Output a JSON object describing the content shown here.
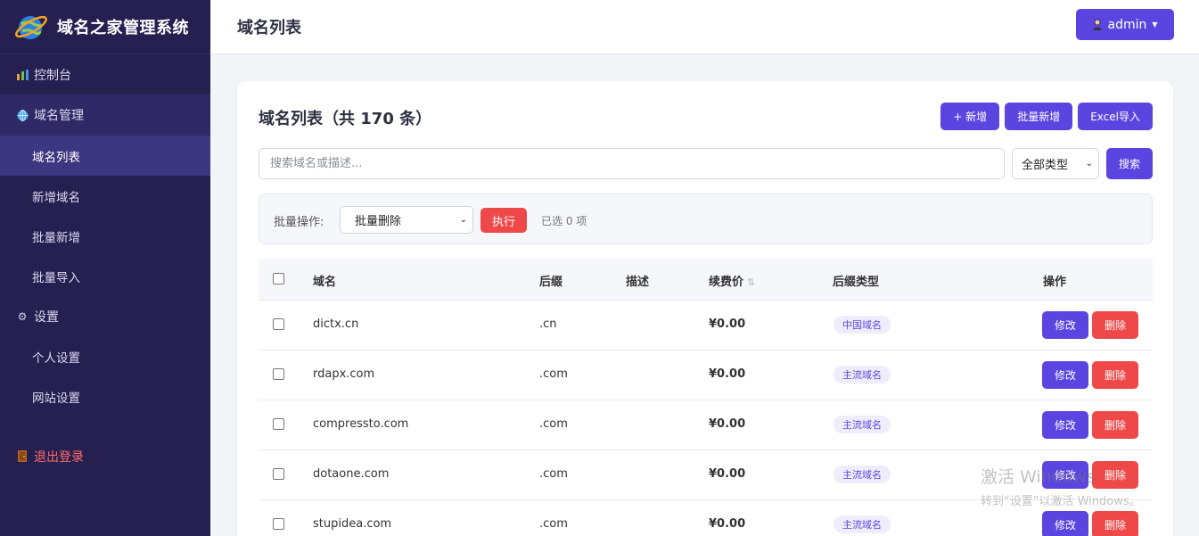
{
  "brand": {
    "title": "域名之家管理系统",
    "logo_icon": "globe-logo-icon"
  },
  "sidebar": {
    "items": [
      {
        "label": "控制台",
        "icon": "chart-icon"
      },
      {
        "label": "域名管理",
        "icon": "globe-icon"
      },
      {
        "label": "域名列表"
      },
      {
        "label": "新增域名"
      },
      {
        "label": "批量新增"
      },
      {
        "label": "批量导入"
      },
      {
        "label": "设置",
        "icon": "gear-icon"
      },
      {
        "label": "个人设置"
      },
      {
        "label": "网站设置"
      },
      {
        "label": "退出登录",
        "icon": "door-icon"
      }
    ]
  },
  "header": {
    "title": "域名列表",
    "user": "admin"
  },
  "card": {
    "title": "域名列表（共 170 条）",
    "add_label": "+ 新增",
    "batch_add_label": "批量新增",
    "excel_label": "Excel导入"
  },
  "search": {
    "placeholder": "搜索域名或描述...",
    "type_selected": "全部类型",
    "button": "搜索"
  },
  "batch": {
    "label": "批量操作:",
    "selected_op": "批量删除",
    "exec": "执行",
    "count_text": "已选 0 项"
  },
  "table": {
    "columns": [
      "域名",
      "后缀",
      "描述",
      "续费价",
      "后缀类型",
      "操作"
    ],
    "edit_label": "修改",
    "delete_label": "删除",
    "rows": [
      {
        "domain": "dictx.cn",
        "suffix": ".cn",
        "description": "",
        "price": "¥0.00",
        "type": "中国域名"
      },
      {
        "domain": "rdapx.com",
        "suffix": ".com",
        "description": "",
        "price": "¥0.00",
        "type": "主流域名"
      },
      {
        "domain": "compressto.com",
        "suffix": ".com",
        "description": "",
        "price": "¥0.00",
        "type": "主流域名"
      },
      {
        "domain": "dotaone.com",
        "suffix": ".com",
        "description": "",
        "price": "¥0.00",
        "type": "主流域名"
      },
      {
        "domain": "stupidea.com",
        "suffix": ".com",
        "description": "",
        "price": "¥0.00",
        "type": "主流域名"
      }
    ]
  },
  "watermark": {
    "line1": "激活 Windows",
    "line2": "转到“设置”以激活 Windows。"
  },
  "colors": {
    "sidebar": "#262050",
    "accent": "#5b45e0",
    "danger": "#ef4848"
  }
}
